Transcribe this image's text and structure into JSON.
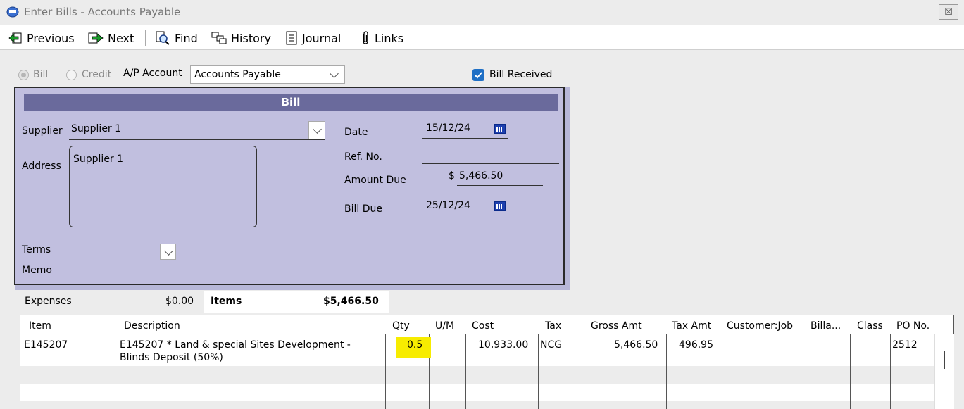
{
  "window": {
    "title": "Enter Bills - Accounts Payable",
    "close_symbol": "☒"
  },
  "toolbar": {
    "previous": "Previous",
    "next": "Next",
    "find": "Find",
    "history": "History",
    "journal": "Journal",
    "links": "Links"
  },
  "options": {
    "bill_label": "Bill",
    "credit_label": "Credit",
    "ap_account_label": "A/P Account",
    "ap_account_value": "Accounts Payable",
    "bill_received_label": "Bill Received"
  },
  "bill": {
    "header": "Bill",
    "supplier_label": "Supplier",
    "supplier_value": "Supplier 1",
    "address_label": "Address",
    "address_value": "Supplier 1",
    "date_label": "Date",
    "date_value": "15/12/24",
    "ref_label": "Ref. No.",
    "ref_value": "",
    "amount_due_label": "Amount Due",
    "currency": "$",
    "amount_due_value": "5,466.50",
    "bill_due_label": "Bill Due",
    "bill_due_value": "25/12/24",
    "terms_label": "Terms",
    "terms_value": "",
    "memo_label": "Memo",
    "memo_value": ""
  },
  "tabs": {
    "expenses_label": "Expenses",
    "expenses_total": "$0.00",
    "items_label": "Items",
    "items_total": "$5,466.50"
  },
  "grid": {
    "columns": [
      "Item",
      "Description",
      "Qty",
      "U/M",
      "Cost",
      "Tax",
      "Gross Amt",
      "Tax Amt",
      "Customer:Job",
      "Billa...",
      "Class",
      "PO No."
    ],
    "rows": [
      {
        "item": "E145207",
        "description_line1": "E145207 * Land & special Sites Development -",
        "description_line2": "Blinds Deposit (50%)",
        "qty": "0.5",
        "um": "",
        "cost": "10,933.00",
        "tax": "NCG",
        "gross_amt": "5,466.50",
        "tax_amt": "496.95",
        "customer_job": "",
        "billable": "",
        "class": "",
        "po_no": "2512"
      }
    ]
  },
  "colors": {
    "panel": "#c1bfdf",
    "header": "#6a6a9c",
    "highlight": "#f7ec00",
    "checkbox": "#1e6fc5"
  }
}
